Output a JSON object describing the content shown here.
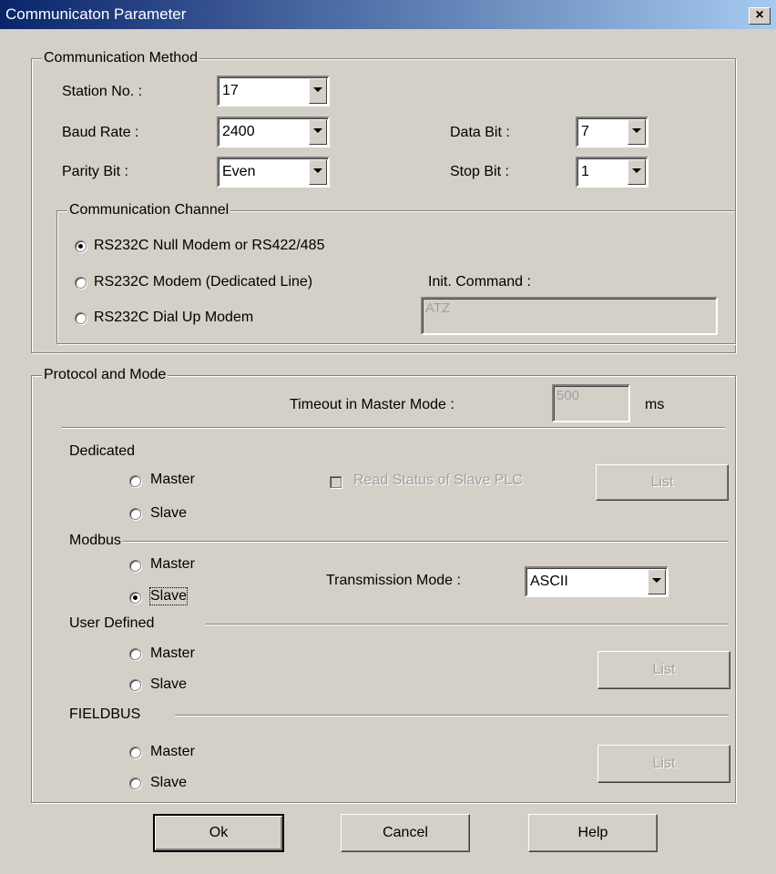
{
  "window": {
    "title": "Communicaton Parameter",
    "close_glyph": "×",
    "close_icon": "close-icon"
  },
  "communication_method": {
    "legend": "Communication Method",
    "station_no": {
      "label": "Station No. :",
      "value": "17"
    },
    "baud_rate": {
      "label": "Baud Rate :",
      "value": "2400"
    },
    "parity_bit": {
      "label": "Parity Bit :",
      "value": "Even"
    },
    "data_bit": {
      "label": "Data Bit :",
      "value": "7"
    },
    "stop_bit": {
      "label": "Stop Bit :",
      "value": "1"
    },
    "channel": {
      "legend": "Communication Channel",
      "options": [
        {
          "label": "RS232C Null Modem or RS422/485",
          "selected": true
        },
        {
          "label": "RS232C Modem (Dedicated Line)",
          "selected": false
        },
        {
          "label": "RS232C Dial Up Modem",
          "selected": false
        }
      ],
      "init_command_label": "Init. Command :",
      "init_command_value": "ATZ"
    }
  },
  "protocol": {
    "legend": "Protocol and Mode",
    "timeout_label": "Timeout in Master Mode :",
    "timeout_value": "500",
    "timeout_unit": "ms",
    "dedicated": {
      "heading": "Dedicated",
      "master": "Master",
      "slave": "Slave",
      "read_status_label": "Read Status of Slave PLC",
      "list_button": "List"
    },
    "modbus": {
      "heading": "Modbus",
      "master": "Master",
      "slave": "Slave",
      "selected": "slave",
      "transmission_label": "Transmission Mode :",
      "transmission_value": "ASCII"
    },
    "user_defined": {
      "heading": "User Defined",
      "master": "Master",
      "slave": "Slave",
      "list_button": "List"
    },
    "fieldbus": {
      "heading": "FIELDBUS",
      "master": "Master",
      "slave": "Slave",
      "list_button": "List"
    }
  },
  "buttons": {
    "ok": "Ok",
    "cancel": "Cancel",
    "help": "Help"
  }
}
